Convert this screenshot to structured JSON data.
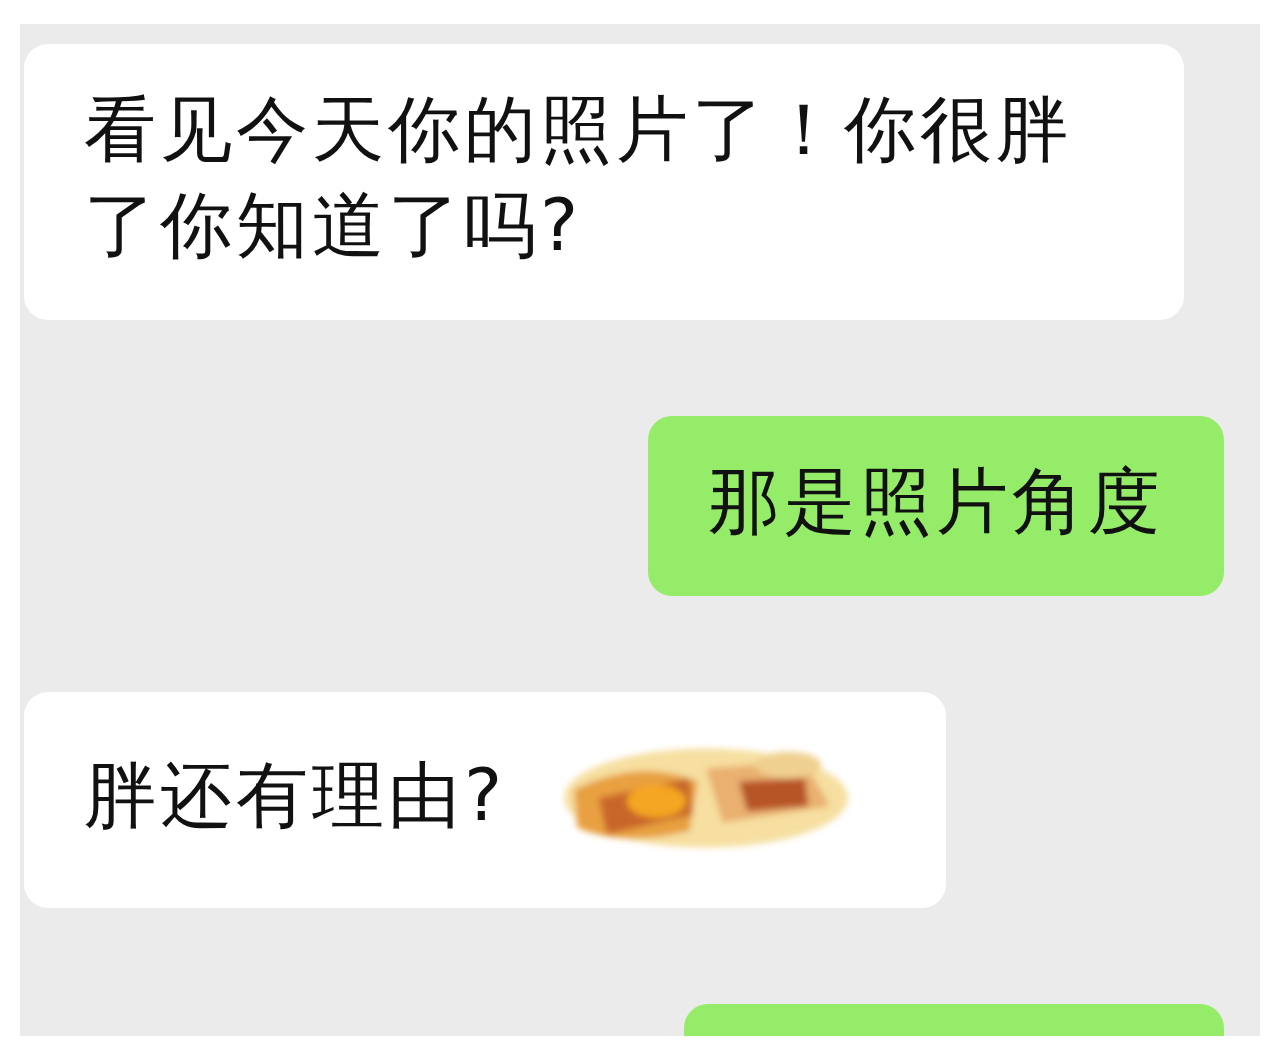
{
  "messages": [
    {
      "from_me": false,
      "text": "看见今天你的照片了！你很胖了你知道了吗?"
    },
    {
      "from_me": true,
      "text": "那是照片角度"
    },
    {
      "from_me": false,
      "text": "胖还有理由?",
      "redacted": true
    },
    {
      "from_me": true,
      "partial": true
    }
  ]
}
